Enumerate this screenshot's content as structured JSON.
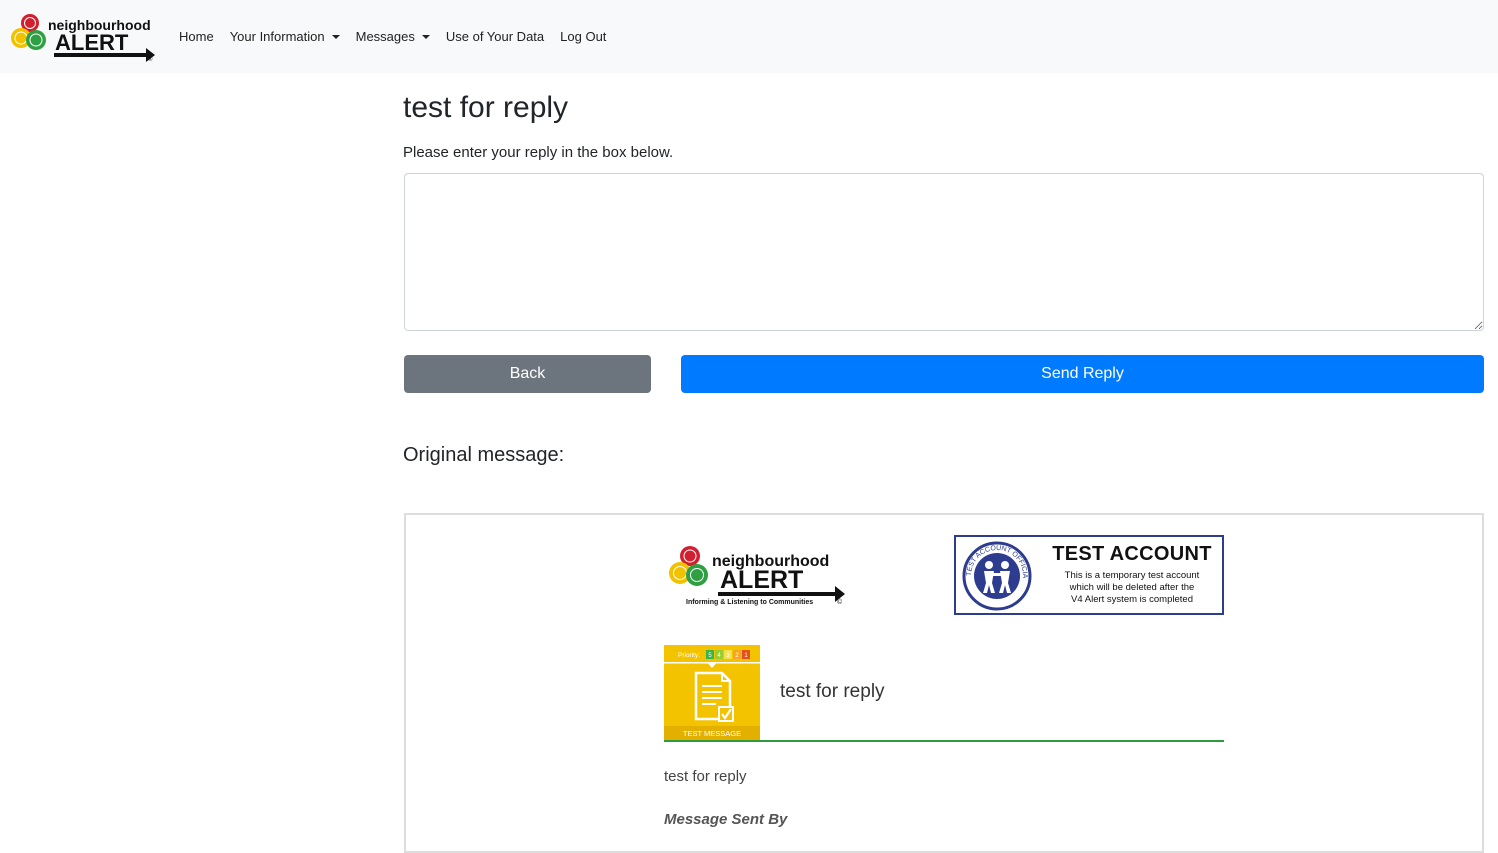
{
  "navbar": {
    "brand": {
      "line1": "neighbourhood",
      "line2": "ALERT",
      "mark": "®"
    },
    "links": [
      {
        "label": "Home",
        "dropdown": false
      },
      {
        "label": "Your Information",
        "dropdown": true
      },
      {
        "label": "Messages",
        "dropdown": true
      },
      {
        "label": "Use of Your Data",
        "dropdown": false
      },
      {
        "label": "Log Out",
        "dropdown": false
      }
    ]
  },
  "main": {
    "title": "test for reply",
    "instructions": "Please enter your reply in the box below.",
    "reply_value": "",
    "back_label": "Back",
    "send_label": "Send Reply",
    "original_heading": "Original message:"
  },
  "email": {
    "logo": {
      "line1": "neighbourhood",
      "line2": "ALERT",
      "tagline": "Informing & Listening to Communities",
      "mark": "©"
    },
    "test_account": {
      "title": "TEST ACCOUNT",
      "line1": "This is a temporary test account",
      "line2": "which will be deleted after the",
      "line3": "V4 Alert system is completed",
      "seal_text": "TEST ACCOUNT OFFICIAL SYSTEM"
    },
    "icon": {
      "priority_label": "Priority:",
      "levels": [
        "5",
        "4",
        "3",
        "2",
        "1"
      ],
      "caption": "TEST MESSAGE"
    },
    "subject": "test for reply",
    "body": "test for reply",
    "sent_by_label": "Message Sent By"
  },
  "colors": {
    "navbar_bg": "#f8f9fa",
    "back_button": "#6c757d",
    "send_button": "#007bff",
    "icon_yellow": "#f3c300",
    "rule_green": "#2e9b3c",
    "test_account_border": "#2d3c8f"
  }
}
